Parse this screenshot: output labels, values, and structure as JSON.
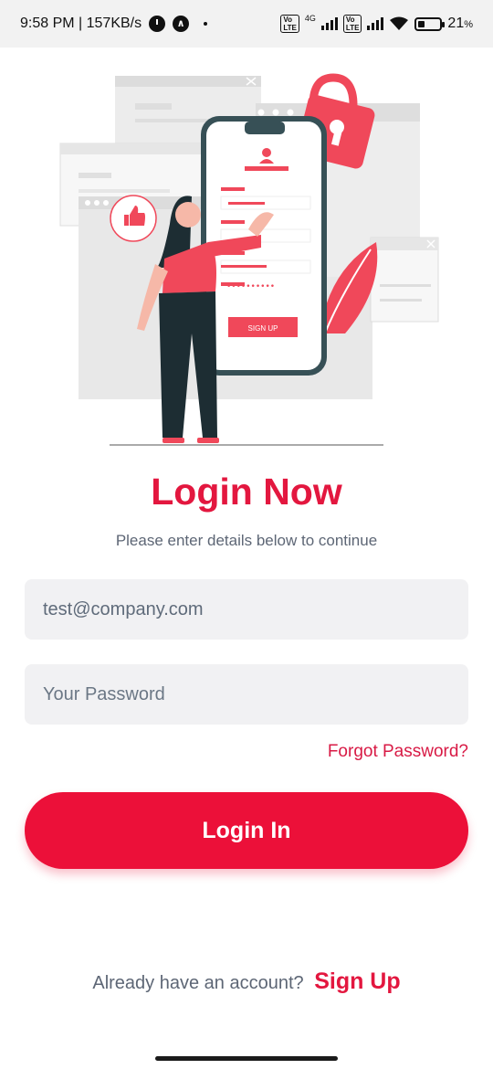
{
  "status_bar": {
    "time_speed": "9:58 PM | 157KB/s",
    "network_type": "4G",
    "volte_label": "Vo LTE",
    "battery_percent": "21",
    "battery_unit": "%",
    "icons": [
      "alarm-icon",
      "nav-arrow-icon",
      "signal-icon",
      "wifi-icon",
      "battery-icon"
    ]
  },
  "illustration": {
    "signup_button_label": "SIGN UP",
    "password_mask": "••••••••••",
    "accent_color": "#f0485a"
  },
  "header": {
    "title": "Login Now",
    "subtitle": "Please enter details below to continue"
  },
  "form": {
    "email_value": "test@company.com",
    "password_placeholder": "Your Password",
    "forgot_label": "Forgot Password?",
    "login_label": "Login In"
  },
  "footer": {
    "prompt": "Already have an account?",
    "signup_label": "Sign Up"
  },
  "colors": {
    "brand": "#e3173f",
    "button": "#ec1039",
    "field_bg": "#f1f1f3"
  }
}
